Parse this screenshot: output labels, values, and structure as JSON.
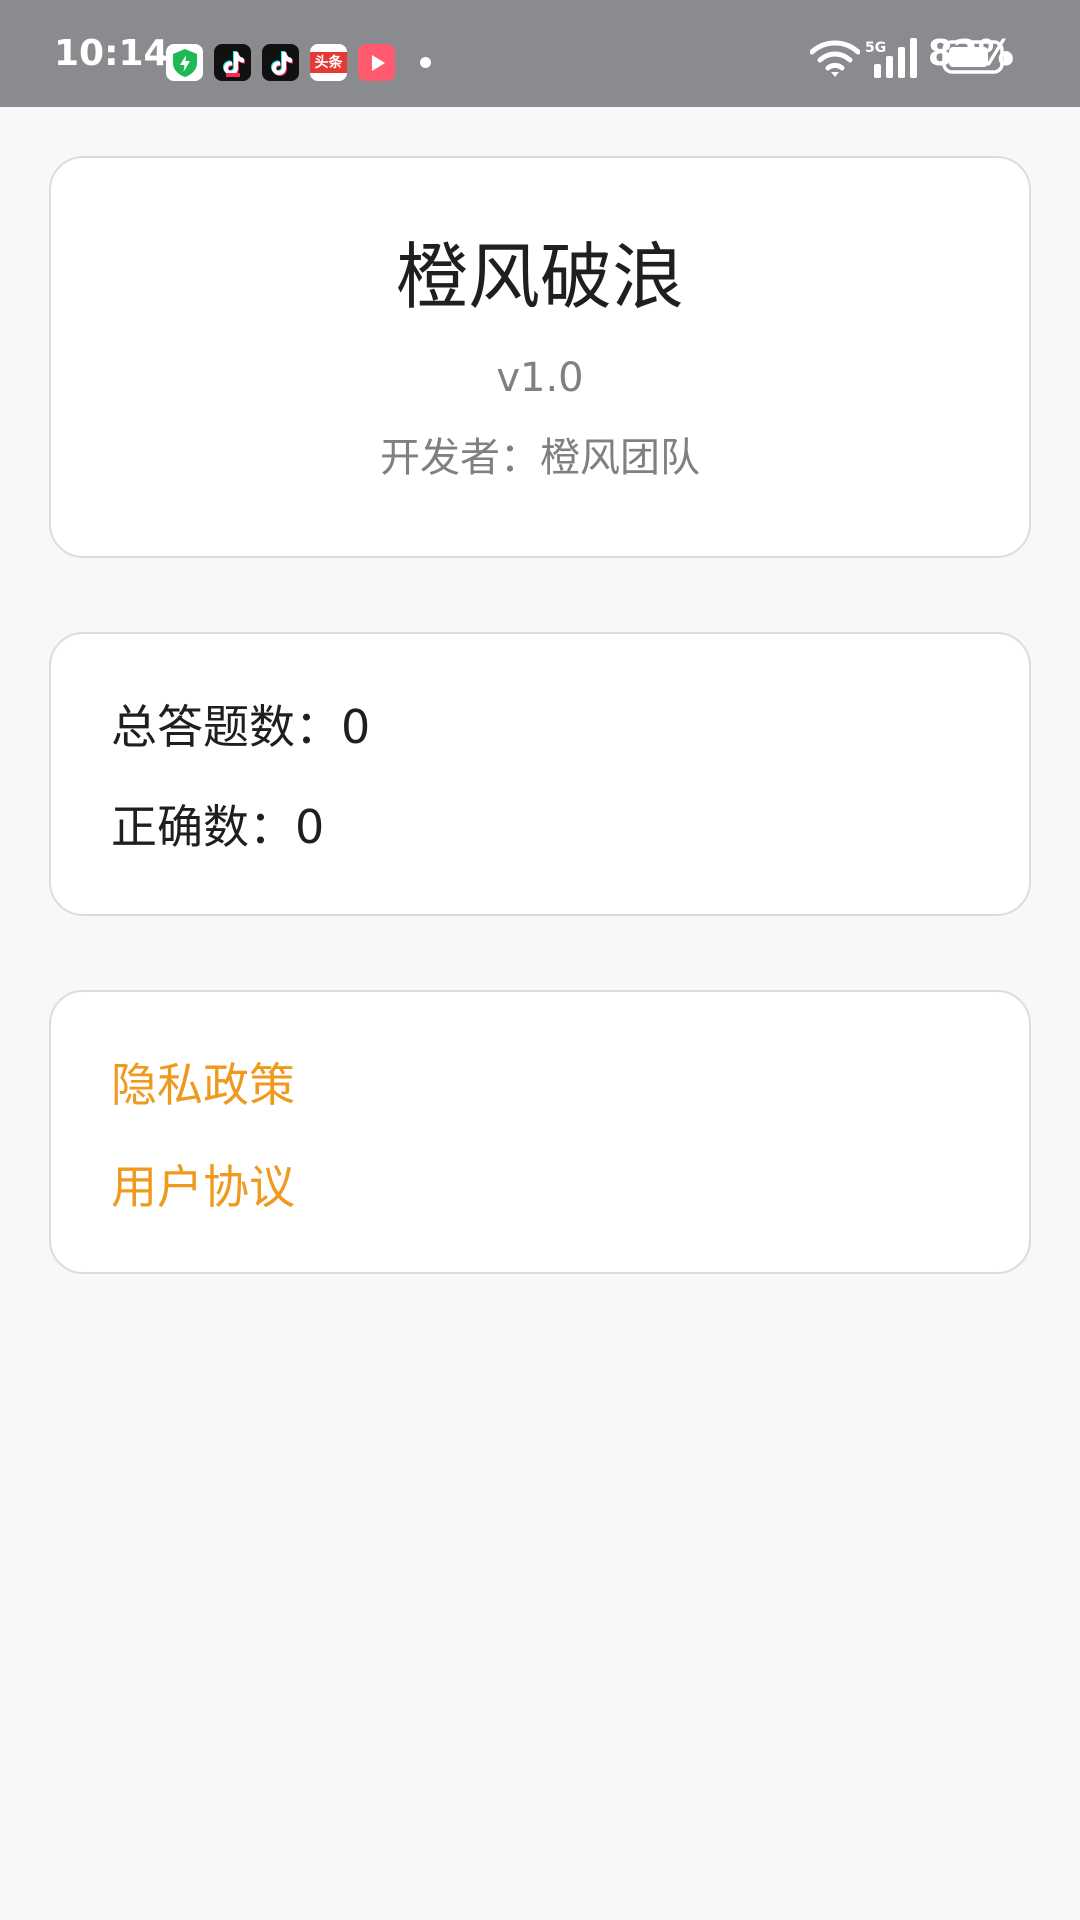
{
  "status_bar": {
    "time": "10:14",
    "network_label": "5G",
    "battery_percent": "82%",
    "battery_level": 0.82,
    "notification_icons": [
      "security-shield-icon",
      "tiktok-lite-icon",
      "tiktok-icon",
      "toutiao-icon",
      "video-player-icon"
    ],
    "toutiao_label": "头条"
  },
  "about": {
    "app_name": "橙风破浪",
    "version": "v1.0",
    "developer": "开发者：橙风团队"
  },
  "stats": {
    "total_label": "总答题数：",
    "total_value": "0",
    "correct_label": "正确数：",
    "correct_value": "0"
  },
  "links": {
    "privacy_policy": "隐私政策",
    "user_agreement": "用户协议"
  },
  "colors": {
    "accent": "#ef9a1e",
    "status_bar_bg": "#8a8b8f",
    "page_bg": "#f7f8fa"
  }
}
